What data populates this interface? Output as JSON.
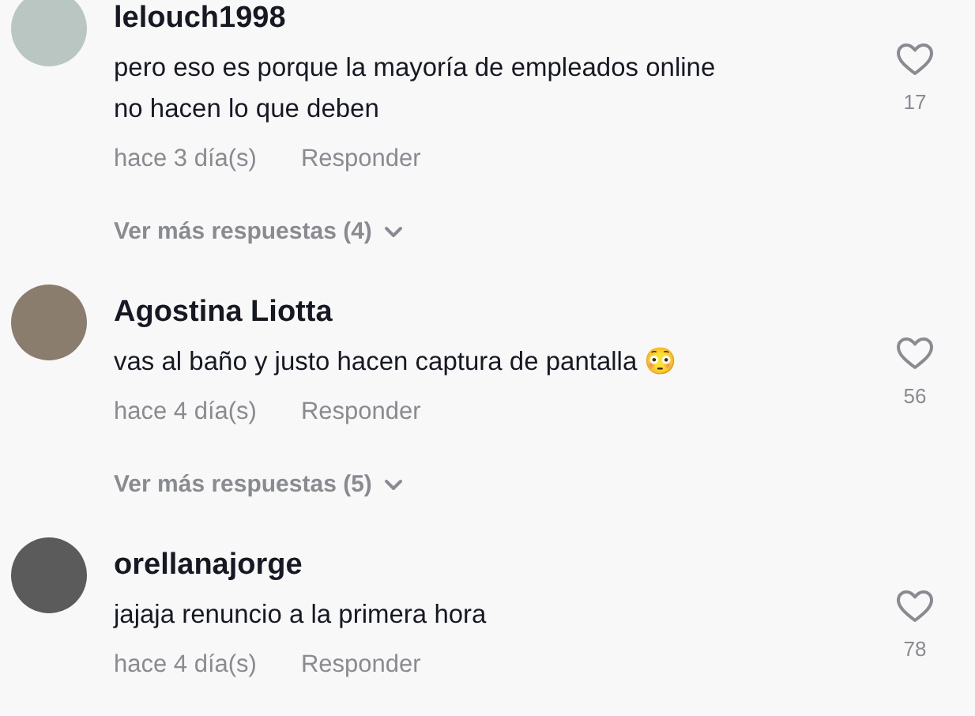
{
  "comments": [
    {
      "username": "lelouch1998",
      "text": "pero eso es porque la mayoría de empleados online no hacen lo que deben",
      "time": "hace 3 día(s)",
      "reply": "Responder",
      "likes": "17",
      "more_replies": "Ver más respuestas (4)"
    },
    {
      "username": "Agostina Liotta",
      "text": "vas al baño y justo hacen captura de pantalla 😳",
      "time": "hace 4 día(s)",
      "reply": "Responder",
      "likes": "56",
      "more_replies": "Ver más respuestas (5)"
    },
    {
      "username": "orellanajorge",
      "text": "jajaja renuncio a la primera hora",
      "time": "hace 4 día(s)",
      "reply": "Responder",
      "likes": "78"
    }
  ]
}
